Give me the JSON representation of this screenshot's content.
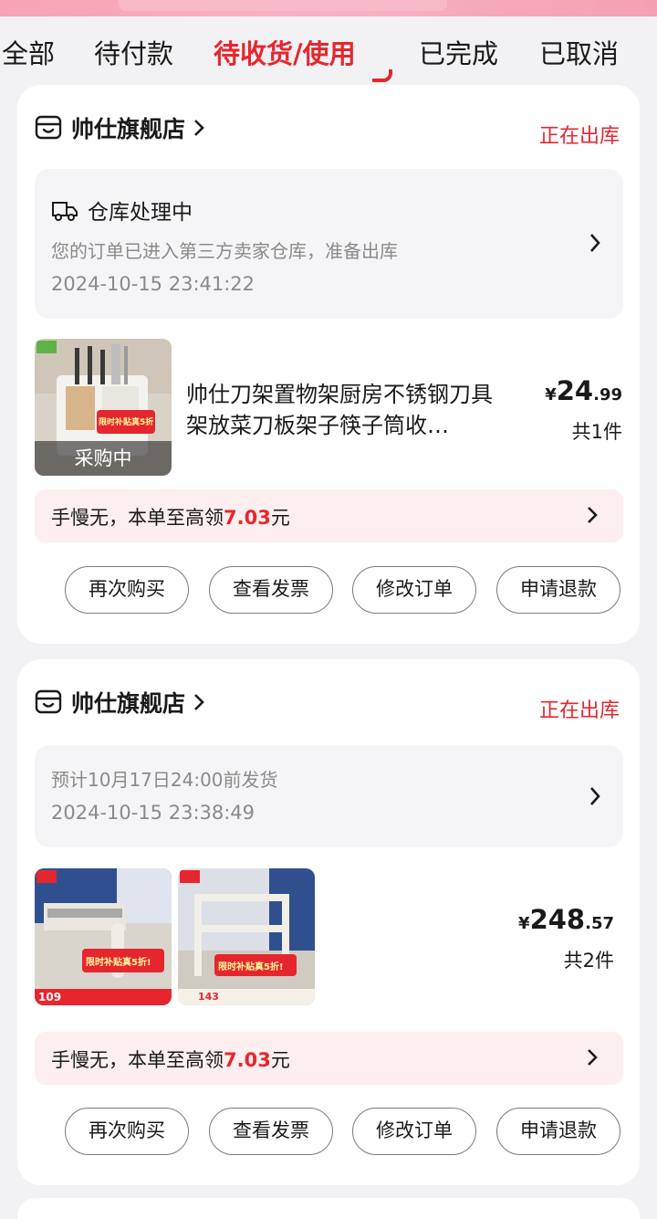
{
  "tabs": [
    {
      "label": "全部",
      "active": false
    },
    {
      "label": "待付款",
      "active": false
    },
    {
      "label": "待收货/使用",
      "active": true
    },
    {
      "label": "已完成",
      "active": false
    },
    {
      "label": "已取消",
      "active": false
    }
  ],
  "colors": {
    "accent": "#e6262e",
    "card_bg": "#ffffff",
    "page_bg": "#f2f2f4",
    "panel_bg": "#f5f5f7",
    "promo_bg": "#fdeeef"
  },
  "orders": [
    {
      "shop_name": "帅仕旗舰店",
      "shop_icon": "store-icon",
      "status": "正在出库",
      "logistics": {
        "title": "仓库处理中",
        "icon": "truck-icon",
        "desc": "您的订单已进入第三方卖家仓库，准备出库",
        "time": "2024-10-15 23:41:22"
      },
      "product": {
        "title": "帅仕刀架置物架厨房不锈钢刀具架放菜刀板架子筷子筒收…",
        "thumb_badge": "采购中",
        "thumb_overlay_text": "限时补贴真5折!"
      },
      "price": {
        "symbol": "¥",
        "integer": "24",
        "decimal": ".99"
      },
      "count": "共1件",
      "promo": {
        "prefix": "手慢无，本单至高领",
        "amount": "7.03",
        "suffix": "元"
      },
      "actions": [
        "再次购买",
        "查看发票",
        "修改订单",
        "申请退款"
      ]
    },
    {
      "shop_name": "帅仕旗舰店",
      "shop_icon": "store-icon",
      "status": "正在出库",
      "logistics": {
        "desc": "预计10月17日24:00前发货",
        "time": "2024-10-15 23:38:49"
      },
      "products": [
        {
          "thumb_overlay_text": "限时补贴真5折!",
          "thumb_price": "109"
        },
        {
          "thumb_overlay_text": "限时补贴真5折!",
          "thumb_price": "143"
        }
      ],
      "price": {
        "symbol": "¥",
        "integer": "248",
        "decimal": ".57"
      },
      "count": "共2件",
      "promo": {
        "prefix": "手慢无，本单至高领",
        "amount": "7.03",
        "suffix": "元"
      },
      "actions": [
        "再次购买",
        "查看发票",
        "修改订单",
        "申请退款"
      ]
    }
  ]
}
